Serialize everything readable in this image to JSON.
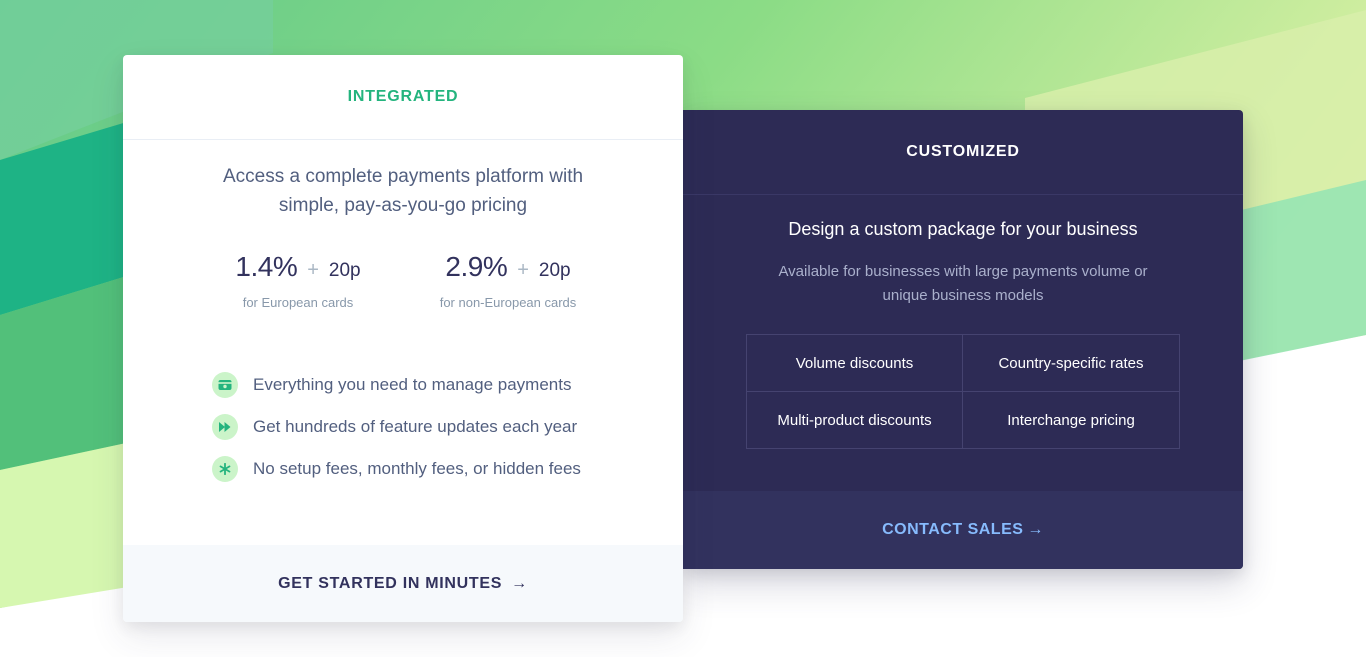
{
  "colors": {
    "accent_green": "#24b47e",
    "navy": "#2d2b55",
    "link_blue": "#87bbfd",
    "icon_bg": "#cbf4c9"
  },
  "integrated": {
    "title": "INTEGRATED",
    "description": "Access a complete payments platform with simple, pay-as-you-go pricing",
    "rates": [
      {
        "percent": "1.4%",
        "plus": "+",
        "fixed": "20p",
        "label": "for European cards"
      },
      {
        "percent": "2.9%",
        "plus": "+",
        "fixed": "20p",
        "label": "for non-European cards"
      }
    ],
    "features": [
      {
        "icon": "payments-icon",
        "text": "Everything you need to manage payments"
      },
      {
        "icon": "fast-forward-icon",
        "text": "Get hundreds of feature updates each year"
      },
      {
        "icon": "asterisk-icon",
        "text": "No setup fees, monthly fees, or hidden fees"
      }
    ],
    "cta_label": "GET STARTED IN MINUTES",
    "cta_arrow": "→"
  },
  "customized": {
    "title": "CUSTOMIZED",
    "heading": "Design a custom package for your business",
    "subtext": "Available for businesses with large payments volume or unique business models",
    "options": [
      "Volume discounts",
      "Country-specific rates",
      "Multi-product discounts",
      "Interchange pricing"
    ],
    "cta_label": "CONTACT SALES",
    "cta_arrow": "→"
  }
}
